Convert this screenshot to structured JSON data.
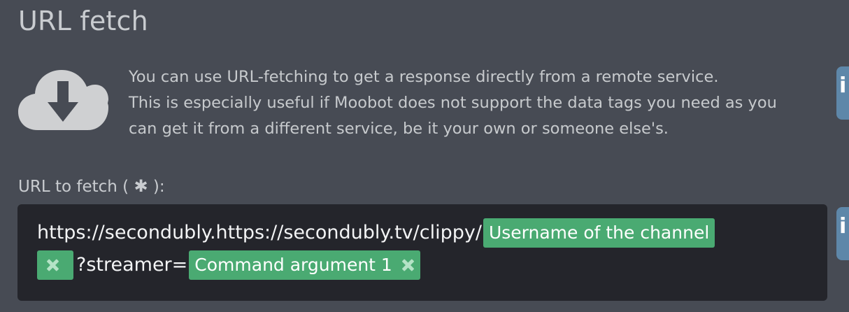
{
  "section": {
    "title": "URL fetch"
  },
  "info": {
    "icon": "cloud-download-icon",
    "lines": [
      "You can use URL-fetching to get a response directly from a remote service.",
      "This is especially useful if Moobot does not support the data tags you need as you",
      "can get it from a different service, be it your own or someone else's."
    ],
    "side_icon": "info-icon"
  },
  "url_field": {
    "label_prefix": "URL to fetch ( ",
    "required_mark": "✱",
    "label_suffix": " ):",
    "text_before_tag1": "https://secondubly.https://secondubly.tv/clippy/",
    "tag1_label": "Username of the channel",
    "text_between": "?streamer=",
    "tag2_label": "Command argument 1"
  },
  "colors": {
    "background": "#474b54",
    "input_background": "#24252b",
    "tag_green": "#4aaa72",
    "side_tab_blue": "#5e87a9"
  }
}
